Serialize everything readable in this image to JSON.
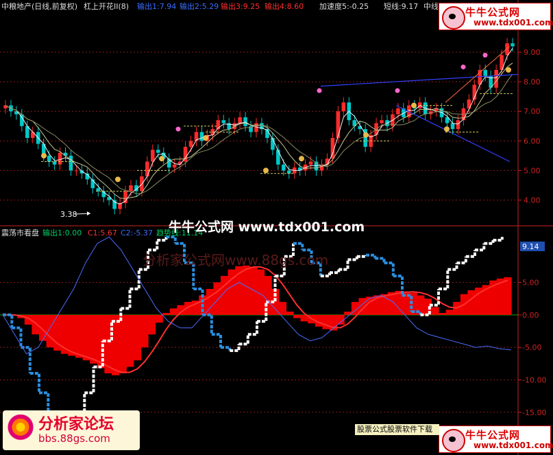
{
  "top_header": {
    "stock": "中粮地产(日线,前复权)",
    "indicator": "杠上开花II(8)",
    "out1": "输出1:7.94",
    "out2": "输出2:5.29",
    "out3": "输出3:9.25",
    "out4": "输出4:8.60",
    "accel": "加速度5:-0.25",
    "short": "短线:9.17",
    "mid": "中线"
  },
  "sub_header": {
    "name": "震荡市看盘",
    "out1": "输出1:0.00",
    "c1": "C1:5.67",
    "c2": "C2:-5.37",
    "trend": "趋势线:11.14"
  },
  "watermarks": {
    "center": "牛牛公式网 www.tdx001.com",
    "faded": "分析家公式网www.88gs.com"
  },
  "badge": {
    "title": "牛牛公式网",
    "url": "www.tdx001.com"
  },
  "logo": {
    "title": "分析家论坛",
    "url": "bbs.88gs.com"
  },
  "footer_note": "股票公式股票软件下载",
  "low_label": "3.38",
  "colors": {
    "up": "#ff2b2b",
    "down": "#00c8c8",
    "grid": "#8a1a1a",
    "axis": "#cc2222",
    "ma": "#e0e0c0",
    "hist": "#ee0000",
    "blue": "#2a8fe0",
    "white": "#ffffff",
    "thin": "#4a6cff"
  },
  "chart_data": [
    {
      "type": "candlestick",
      "title": "中粮地产(日线,前复权)",
      "y_ticks": [
        4.0,
        5.0,
        6.0,
        7.0,
        8.0,
        9.0
      ],
      "ylim": [
        3.2,
        10.3
      ],
      "close": [
        7.2,
        7.0,
        6.9,
        6.5,
        6.1,
        6.3,
        5.9,
        5.5,
        5.3,
        5.2,
        5.6,
        5.5,
        5.0,
        5.0,
        4.9,
        4.7,
        4.4,
        4.3,
        4.1,
        4.0,
        3.7,
        3.9,
        4.3,
        4.5,
        4.3,
        4.8,
        5.3,
        5.7,
        5.6,
        5.4,
        5.1,
        5.2,
        5.3,
        5.8,
        6.0,
        6.3,
        6.0,
        6.2,
        6.4,
        6.7,
        6.6,
        6.4,
        6.6,
        6.8,
        6.5,
        6.3,
        6.6,
        6.4,
        6.1,
        5.7,
        5.2,
        5.0,
        4.9,
        5.1,
        5.0,
        5.2,
        5.3,
        5.0,
        5.2,
        5.4,
        6.1,
        7.0,
        7.3,
        6.7,
        6.5,
        6.4,
        5.8,
        6.2,
        6.6,
        6.7,
        6.5,
        6.9,
        7.1,
        6.8,
        7.2,
        7.1,
        7.3,
        6.9,
        7.0,
        7.1,
        6.8,
        6.6,
        6.4,
        6.7,
        7.1,
        7.4,
        7.9,
        8.4,
        8.2,
        7.8,
        8.4,
        8.9,
        9.3,
        9.2
      ],
      "low_marker": 3.38,
      "series_lines": [
        "ma_short",
        "ma_mid",
        "ma_long"
      ]
    },
    {
      "type": "oscillator",
      "title": "震荡市看盘",
      "y_ticks": [
        5.0,
        0.0,
        -5.0,
        -10.0,
        -15.0
      ],
      "ylim": [
        -16.5,
        11.5
      ],
      "trend_label": "9.14",
      "hist": [
        0,
        0,
        -0.5,
        -1.5,
        -3,
        -4,
        -5,
        -5.5,
        -6,
        -6.3,
        -6.6,
        -7,
        -7.5,
        -8.2,
        -9,
        -9.3,
        -9,
        -8,
        -7,
        -5,
        -3,
        -1.2,
        0.3,
        1,
        1.5,
        2,
        2.2,
        3,
        4,
        5,
        6,
        7,
        7.5,
        7.6,
        7.4,
        7,
        6,
        4,
        2,
        0.5,
        -0.5,
        -1,
        -1.3,
        -1.8,
        -2.2,
        -2.4,
        -1.5,
        0.5,
        2,
        2.6,
        2.8,
        3,
        3.2,
        3.5,
        3.7,
        3.6,
        3.4,
        3,
        2.5,
        1.2,
        0.3,
        0.8,
        2,
        3.2,
        3.8,
        4.2,
        4.6,
        5.3,
        5.6,
        5.8
      ],
      "white_line": [
        0,
        -2,
        -5,
        -9,
        -12,
        -15,
        -17,
        -17,
        -15,
        -12,
        -8,
        -4,
        -1,
        1,
        4,
        7,
        10,
        11.5,
        12,
        11,
        8,
        4,
        0,
        -3,
        -5,
        -5.5,
        -4.5,
        -3,
        -1,
        2,
        6,
        9,
        11,
        10,
        8,
        6,
        6.5,
        7,
        8.5,
        9,
        9.2,
        8.7,
        8,
        6,
        3,
        0.5,
        0,
        1.5,
        4,
        7,
        8,
        9,
        10,
        11,
        11.5,
        12
      ],
      "thin_line": [
        0,
        -3,
        -6,
        -5,
        -2,
        1,
        4,
        8,
        11,
        12,
        10,
        7,
        4,
        1,
        -1,
        -2,
        -2,
        0,
        2,
        4,
        5,
        4,
        3,
        1,
        -1,
        -3,
        -4,
        -3.5,
        -2,
        -0.5,
        1,
        2.5,
        3,
        2,
        0,
        -2,
        -3,
        -3.5,
        -4,
        -4.5,
        -5,
        -4.8,
        -5.2,
        -5.4
      ]
    }
  ]
}
